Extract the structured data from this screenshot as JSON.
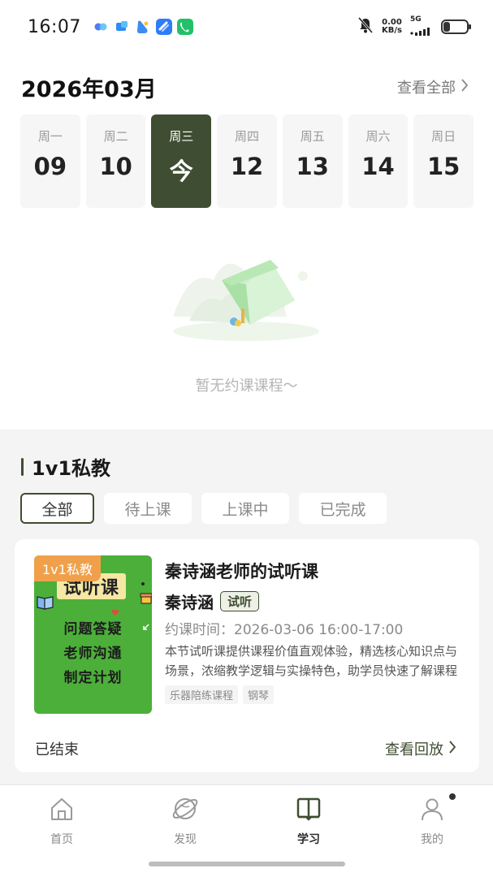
{
  "status_bar": {
    "time": "16:07",
    "net_speed_value": "0.00",
    "net_speed_unit": "KB/s",
    "network": "5G",
    "icons": [
      "app-blue-dots-icon",
      "app-blue-square-icon",
      "app-blue-fish-icon",
      "app-blue-link-icon",
      "app-green-phone-icon",
      "mute-bell-icon",
      "signal-icon",
      "battery-icon"
    ]
  },
  "calendar": {
    "month_title": "2026年03月",
    "view_all": "查看全部",
    "days": [
      {
        "dow": "周一",
        "num": "09"
      },
      {
        "dow": "周二",
        "num": "10"
      },
      {
        "dow": "周三",
        "num": "今"
      },
      {
        "dow": "周四",
        "num": "12"
      },
      {
        "dow": "周五",
        "num": "13"
      },
      {
        "dow": "周六",
        "num": "14"
      },
      {
        "dow": "周日",
        "num": "15"
      }
    ],
    "selected_index": 2,
    "empty_text": "暂无约课课程～"
  },
  "private_section": {
    "title": "1v1私教",
    "filters": [
      "全部",
      "待上课",
      "上课中",
      "已完成"
    ],
    "active_filter": "全部"
  },
  "course_card": {
    "thumb_tag": "1v1私教",
    "thumb_title": "试听课",
    "thumb_lines": [
      "问题答疑",
      "老师沟通",
      "制定计划"
    ],
    "title": "秦诗涵老师的试听课",
    "teacher": "秦诗涵",
    "badge": "试听",
    "time_label": "约课时间：",
    "time_value": "2026-03-06 16:00-17:00",
    "description": "本节试听课提供课程价值直观体验，精选核心知识点与场景，浓缩教学逻辑与实操特色，助学员快速了解课程",
    "tags": [
      "乐器陪练课程",
      "钢琴"
    ],
    "status": "已结束",
    "action": "查看回放"
  },
  "tabbar": {
    "items": [
      {
        "label": "首页",
        "icon": "home-icon"
      },
      {
        "label": "发现",
        "icon": "planet-icon"
      },
      {
        "label": "学习",
        "icon": "book-icon"
      },
      {
        "label": "我的",
        "icon": "user-icon"
      }
    ],
    "active": "学习"
  },
  "colors": {
    "accent": "#3f4d32",
    "orange_tag": "#f0a04b",
    "thumb_green": "#4caf3a"
  }
}
